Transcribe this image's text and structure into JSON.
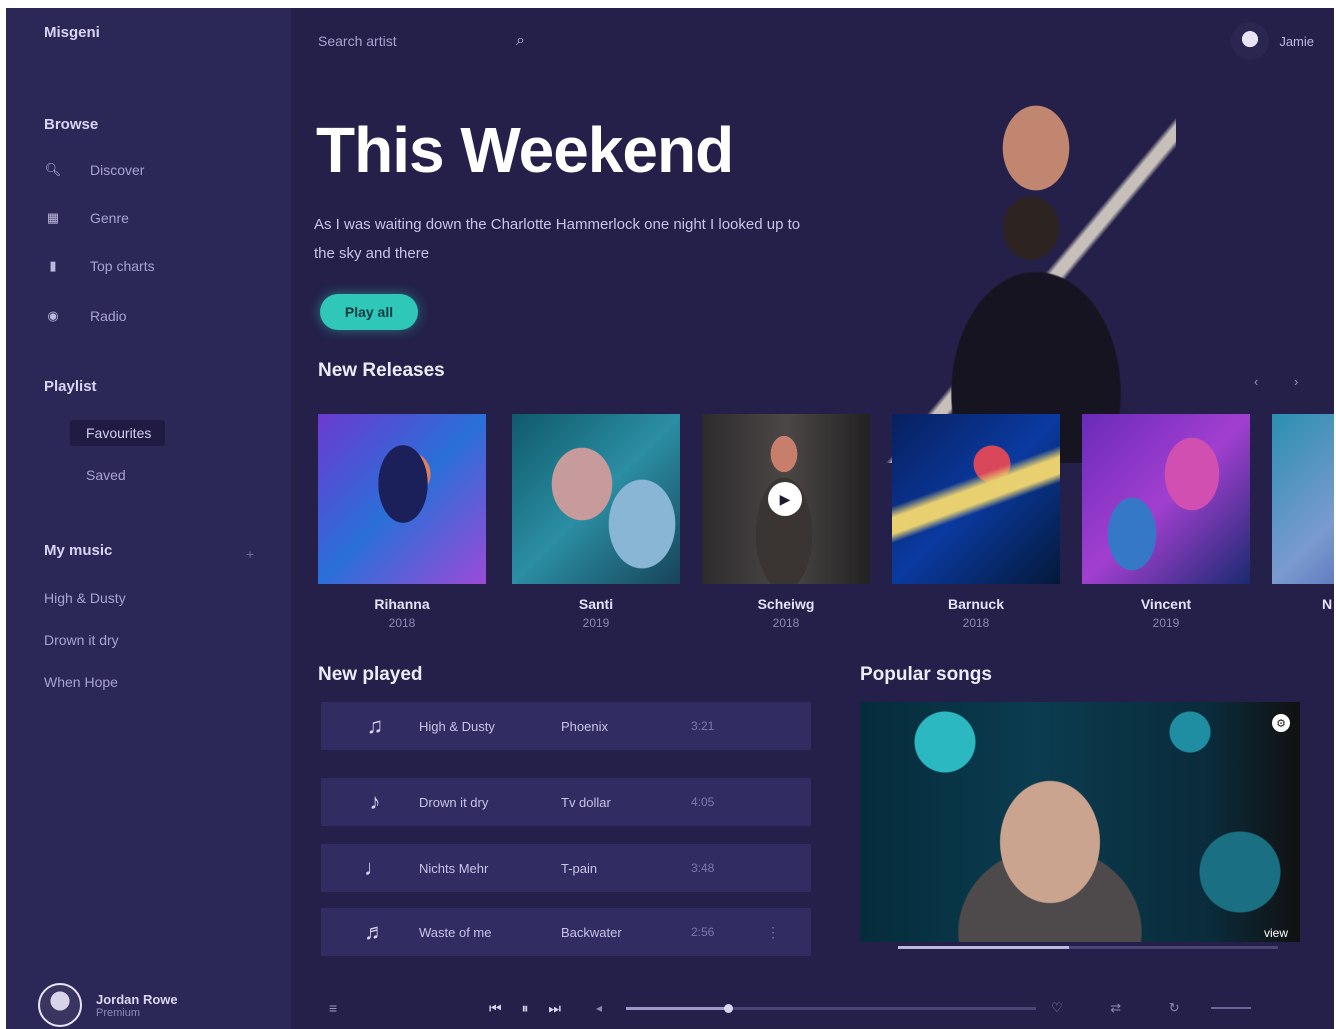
{
  "sidebar": {
    "brand": "Misgeni",
    "browse_title": "Browse",
    "browse_items": [
      {
        "icon": "search-icon",
        "label": "Discover"
      },
      {
        "icon": "grid-icon",
        "label": "Genre"
      },
      {
        "icon": "chart-icon",
        "label": "Top charts"
      },
      {
        "icon": "radio-icon",
        "label": "Radio"
      }
    ],
    "playlist_title": "Playlist",
    "playlist_items": [
      "Favourites",
      "Saved"
    ],
    "mymusic_title": "My music",
    "mymusic_plus": "+",
    "mymusic_items": [
      "High & Dusty",
      "Drown it dry",
      "When Hope"
    ],
    "user": {
      "name": "Jordan Rowe",
      "sub": "Premium"
    }
  },
  "topbar": {
    "search_placeholder": "Search artist",
    "search_icon": "search-icon",
    "profile_name": "Jamie"
  },
  "hero": {
    "title": "This Weekend",
    "description": "As I was waiting down the Charlotte Hammerlock one night I looked up to the sky and there",
    "play_label": "Play all"
  },
  "new_releases": {
    "title": "New Releases",
    "arrows": "‹ ›",
    "albums": [
      {
        "name": "Rihanna",
        "year": "2018"
      },
      {
        "name": "Santi",
        "year": "2019"
      },
      {
        "name": "Scheiwg",
        "year": "2018"
      },
      {
        "name": "Barnuck",
        "year": "2018"
      },
      {
        "name": "Vincent",
        "year": "2019"
      },
      {
        "name": "N",
        "year": ""
      }
    ]
  },
  "recently_played": {
    "title": "New played",
    "tracks": [
      {
        "icon": "guitarist-icon",
        "title": "High & Dusty",
        "artist": "Phoenix",
        "time": "3:21"
      },
      {
        "icon": "drummer-icon",
        "title": "Drown it dry",
        "artist": "Tv dollar",
        "time": "4:05"
      },
      {
        "icon": "singer-icon",
        "title": "Nichts Mehr",
        "artist": "T-pain",
        "time": "3:48"
      },
      {
        "icon": "bassist-icon",
        "title": "Waste of me",
        "artist": "Backwater",
        "time": "2:56"
      }
    ]
  },
  "popular": {
    "title": "Popular songs",
    "more": "view",
    "progress_fraction": 0.45
  },
  "player": {
    "menu_icon": "≡",
    "controls": "⏮ ⏸ ⏭",
    "progress_fraction": 0.25,
    "right_icons": "♡ ⇄ ↻"
  },
  "colors": {
    "background": "#24204a",
    "sidebar": "#2b2757",
    "accent": "#2fc7b8"
  }
}
